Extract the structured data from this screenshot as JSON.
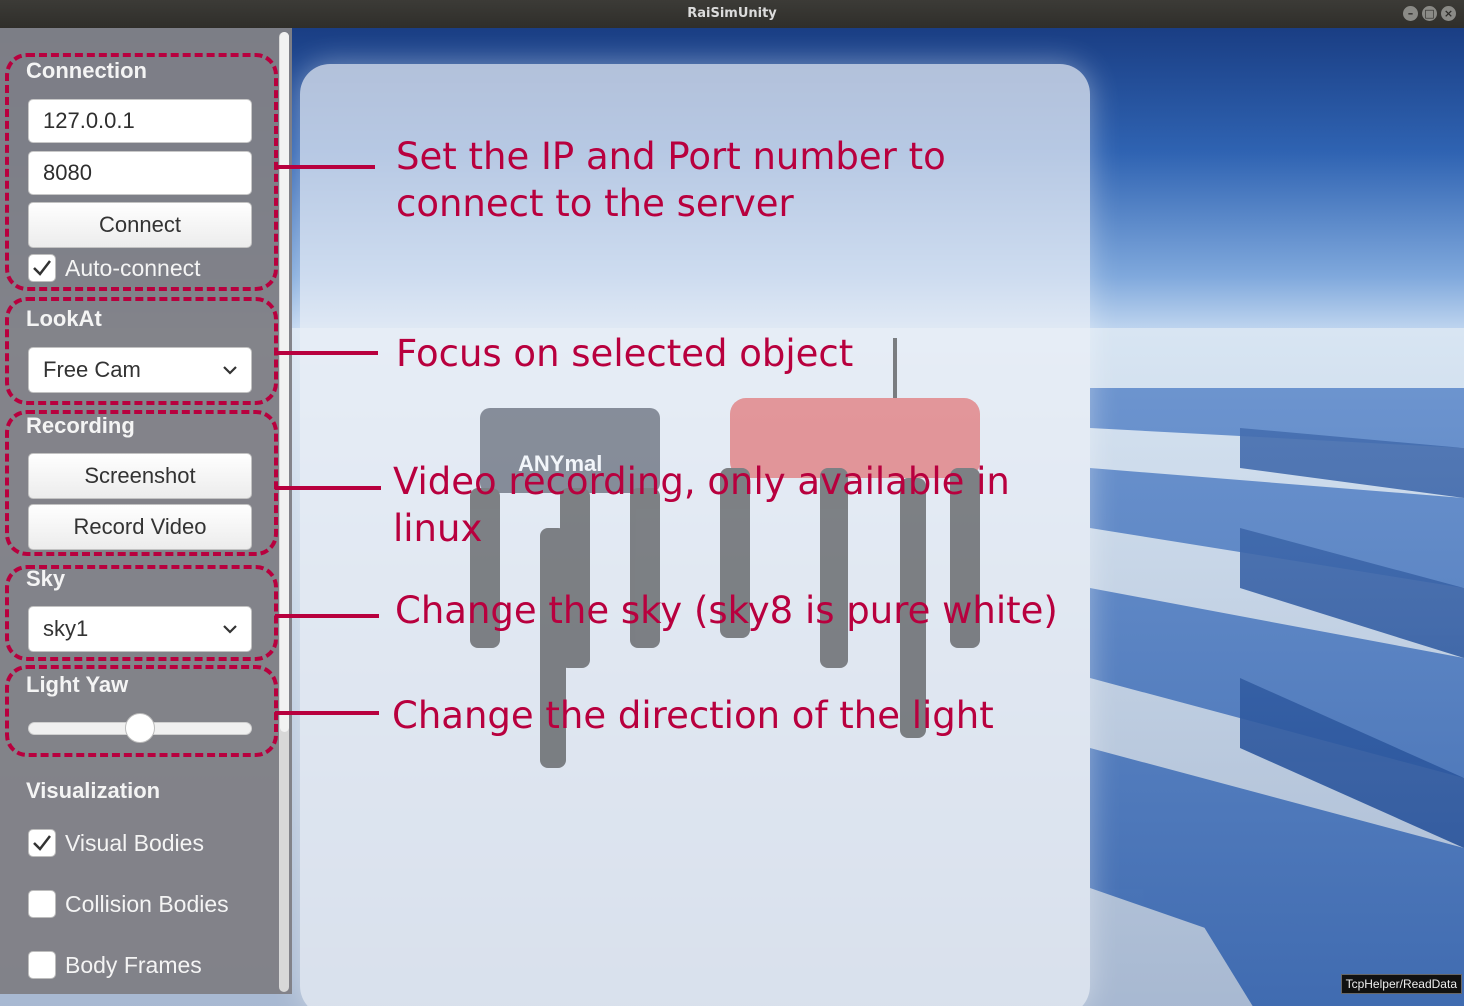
{
  "window": {
    "title": "RaiSimUnity",
    "buttons": [
      "–",
      "□",
      "×"
    ]
  },
  "sidebar": {
    "connection": {
      "header": "Connection",
      "ip": "127.0.0.1",
      "port": "8080",
      "connect_label": "Connect",
      "auto_connect_label": "Auto-connect",
      "auto_connect_checked": true
    },
    "lookat": {
      "header": "LookAt",
      "selected": "Free Cam"
    },
    "recording": {
      "header": "Recording",
      "screenshot_label": "Screenshot",
      "record_label": "Record Video"
    },
    "sky": {
      "header": "Sky",
      "selected": "sky1"
    },
    "light": {
      "header": "Light Yaw",
      "yaw_fraction": 0.5
    },
    "visualization": {
      "header": "Visualization",
      "items": [
        {
          "label": "Visual Bodies",
          "checked": true
        },
        {
          "label": "Collision Bodies",
          "checked": false
        },
        {
          "label": "Body Frames",
          "checked": false
        }
      ]
    }
  },
  "annotations": {
    "connection": [
      "Set the IP and Port number to",
      "connect to the server"
    ],
    "lookat": [
      "Focus on selected object"
    ],
    "recording": [
      "Video recording, only available in",
      "linux"
    ],
    "sky": [
      "Change the sky (sky8 is pure white)"
    ],
    "light": [
      "Change the direction of the light"
    ]
  },
  "robot_logo_text": "ANYmal",
  "status_text": "TcpHelper/ReadData",
  "colors": {
    "annotation": "#b8003e",
    "sidebar": "#808086"
  }
}
